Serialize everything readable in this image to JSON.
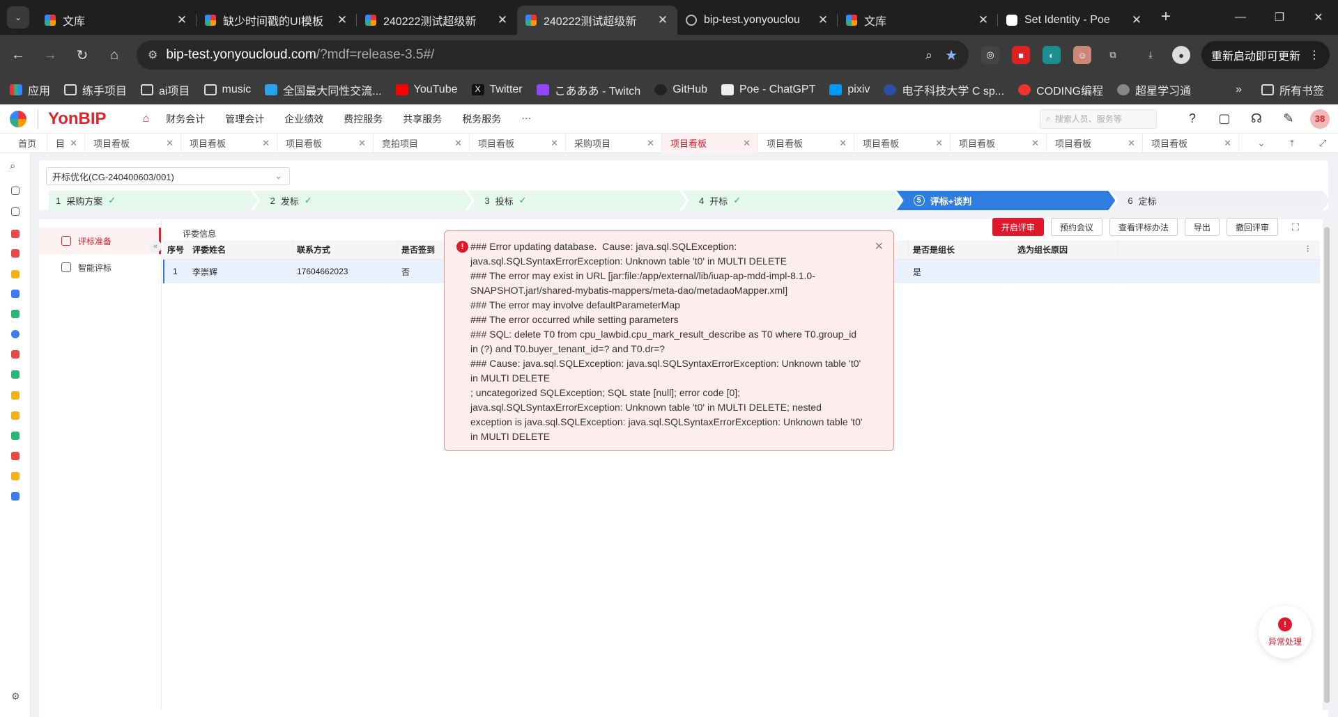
{
  "browser": {
    "tabs": [
      {
        "title": "文库",
        "icon": "yonbip-icon"
      },
      {
        "title": "缺少时间戳的UI模板",
        "icon": "yonbip-icon"
      },
      {
        "title": "240222测试超级新",
        "icon": "yonbip-icon"
      },
      {
        "title": "240222测试超级新",
        "icon": "yonbip-icon",
        "active": true
      },
      {
        "title": "bip-test.yonyouclou",
        "icon": "globe-icon"
      },
      {
        "title": "文库",
        "icon": "yonbip-icon"
      },
      {
        "title": "Set Identity - Poe",
        "icon": "poe-icon"
      }
    ],
    "url_domain": "bip-test.yonyoucloud.com",
    "url_rest": "/?mdf=release-3.5#/",
    "update_label": "重新启动即可更新",
    "bookmarks": [
      {
        "label": "应用"
      },
      {
        "label": "练手项目"
      },
      {
        "label": "ai项目"
      },
      {
        "label": "music"
      },
      {
        "label": "全国最大同性交流..."
      },
      {
        "label": "YouTube"
      },
      {
        "label": "Twitter"
      },
      {
        "label": "こあああ - Twitch"
      },
      {
        "label": "GitHub"
      },
      {
        "label": "Poe - ChatGPT"
      },
      {
        "label": "pixiv"
      },
      {
        "label": "电子科技大学 C sp..."
      },
      {
        "label": "CODING编程"
      },
      {
        "label": "超星学习通"
      }
    ],
    "bookmarks_more": "»",
    "all_bookmarks": "所有书签"
  },
  "app": {
    "brand": "YonBIP",
    "menu": [
      "财务会计",
      "管理会计",
      "企业绩效",
      "费控服务",
      "共享服务",
      "税务服务",
      "···"
    ],
    "search_placeholder": "搜索人员、服务等",
    "page_tabs": [
      "首页",
      "目",
      "项目看板",
      "项目看板",
      "项目看板",
      "竞拍项目",
      "项目看板",
      "采购项目",
      "项目看板",
      "项目看板",
      "项目看板",
      "项目看板",
      "项目看板",
      "项目看板"
    ],
    "current_tab_index": 8,
    "project_select": "开标优化(CG-240400603/001)",
    "steps": [
      {
        "num": "1",
        "label": "采购方案",
        "done": true
      },
      {
        "num": "2",
        "label": "发标",
        "done": true
      },
      {
        "num": "3",
        "label": "投标",
        "done": true
      },
      {
        "num": "4",
        "label": "开标",
        "done": true
      },
      {
        "num": "5",
        "label": "评标+谈判",
        "active": true
      },
      {
        "num": "6",
        "label": "定标"
      }
    ],
    "side_nav": [
      {
        "label": "评标准备",
        "active": true
      },
      {
        "label": "智能评标"
      }
    ],
    "content_tab": "评委信息",
    "buttons": {
      "start_review": "开启评审",
      "book_meeting": "预约会议",
      "view_method": "查看评标办法",
      "export": "导出",
      "withdraw_review": "撤回评审"
    },
    "grid": {
      "columns": [
        "序号",
        "评委姓名",
        "联系方式",
        "是否签到",
        "是否是组长",
        "选为组长原因"
      ],
      "rows": [
        {
          "seq": "1",
          "name": "李崇辉",
          "phone": "17604662023",
          "signed": "否",
          "is_leader": "是",
          "reason": ""
        }
      ]
    },
    "error": {
      "message": "### Error updating database.  Cause: java.sql.SQLException: java.sql.SQLSyntaxErrorException: Unknown table 't0' in MULTI DELETE\n### The error may exist in URL [jar:file:/app/external/lib/iuap-ap-mdd-impl-8.1.0-SNAPSHOT.jar!/shared-mybatis-mappers/meta-dao/metadaoMapper.xml]\n### The error may involve defaultParameterMap\n### The error occurred while setting parameters\n### SQL: delete T0 from cpu_lawbid.cpu_mark_result_describe as T0 where T0.group_id in (?) and T0.buyer_tenant_id=? and T0.dr=?\n### Cause: java.sql.SQLException: java.sql.SQLSyntaxErrorException: Unknown table 't0' in MULTI DELETE\n; uncategorized SQLException; SQL state [null]; error code [0]; java.sql.SQLSyntaxErrorException: Unknown table 't0' in MULTI DELETE; nested exception is java.sql.SQLException: java.sql.SQLSyntaxErrorException: Unknown table 't0' in MULTI DELETE"
    },
    "exception_button": "异常处理"
  },
  "colors": {
    "brand_red": "#d9262c",
    "step_active": "#2f7de1",
    "step_done": "#e6f8ee",
    "error_bg": "#fdeeed"
  }
}
